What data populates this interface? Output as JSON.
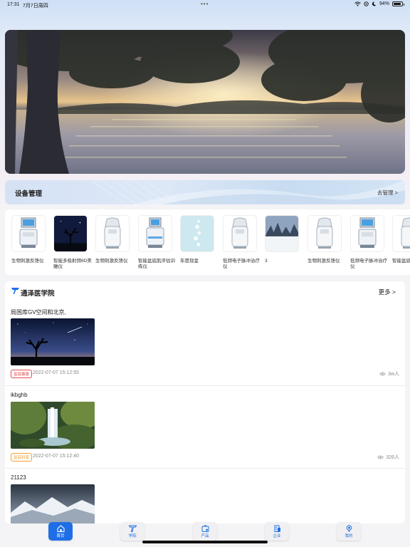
{
  "status_bar": {
    "time": "17:31",
    "date": "7月7日周四",
    "battery": "94%",
    "battery_level": 0.94
  },
  "device_management": {
    "title": "设备管理",
    "link": "去管理 >"
  },
  "products": [
    {
      "name": "生物刺激反馈仪",
      "icon": "machine-icon"
    },
    {
      "name": "智能多极射频8D美雕仪",
      "icon": "photo-tree-icon"
    },
    {
      "name": "生物刺激反馈仪",
      "icon": "machine-icon"
    },
    {
      "name": "智能盆底肌评估训练仪",
      "icon": "machine-icon"
    },
    {
      "name": "年度现金",
      "icon": "photo-bubbles-icon"
    },
    {
      "name": "低频电子脉冲治疗仪",
      "icon": "machine-icon"
    },
    {
      "name": "3",
      "icon": "photo-snow-icon"
    },
    {
      "name": "生物刺激反馈仪",
      "icon": "machine-icon"
    },
    {
      "name": "低频电子脉冲治疗仪",
      "icon": "machine-icon"
    },
    {
      "name": "智能盆底肌恢复",
      "icon": "machine-icon"
    }
  ],
  "academy": {
    "title": "通泽医学院",
    "more": "更多",
    "articles": [
      {
        "title": "局国库GV空间和北京,",
        "tag": "盆底健康",
        "tag_color": "#e5484d",
        "date": "2022-07-07 15:12:55",
        "views": "3w人"
      },
      {
        "title": "ikbghb",
        "tag": "盆底科普",
        "tag_color": "#f0a236",
        "date": "2022-07-07 15:12:40",
        "views": "326人"
      },
      {
        "title": "21123"
      }
    ]
  },
  "tabbar": {
    "tabs": [
      {
        "label": "首页"
      },
      {
        "label": "学院"
      },
      {
        "label": "产品"
      },
      {
        "label": "企业"
      },
      {
        "label": "我的"
      }
    ]
  },
  "colors": {
    "accent": "#1e6fe6"
  }
}
